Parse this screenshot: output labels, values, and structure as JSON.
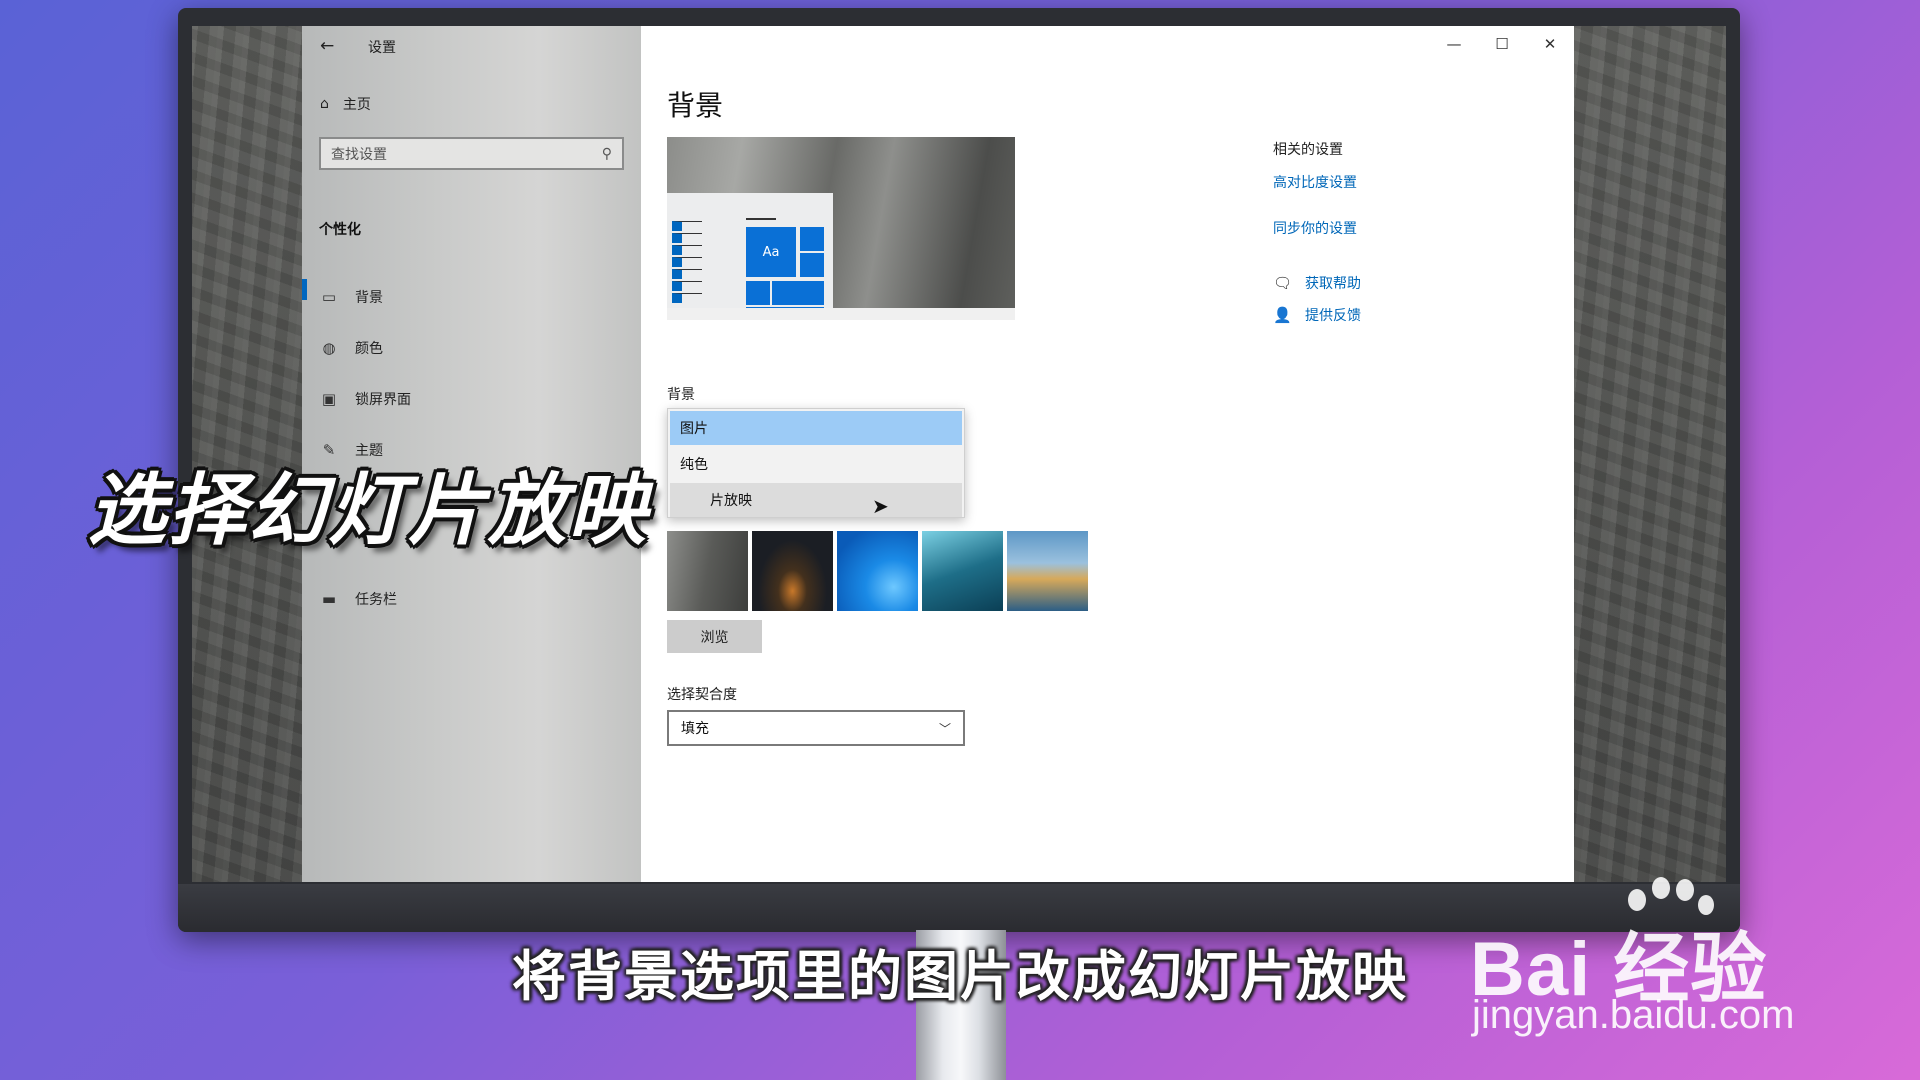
{
  "window": {
    "back_icon": "back-arrow-icon",
    "title": "设置",
    "controls": {
      "minimize": "—",
      "maximize": "☐",
      "close": "✕"
    }
  },
  "sidebar": {
    "home_label": "主页",
    "search_placeholder": "查找设置",
    "section_title": "个性化",
    "items": [
      {
        "label": "背景",
        "icon": "image-icon",
        "active": true
      },
      {
        "label": "颜色",
        "icon": "palette-icon",
        "active": false
      },
      {
        "label": "锁屏界面",
        "icon": "lock-screen-icon",
        "active": false
      },
      {
        "label": "主题",
        "icon": "theme-icon",
        "active": false
      },
      {
        "label": "",
        "icon": "",
        "active": false
      },
      {
        "label": "",
        "icon": "",
        "active": false
      },
      {
        "label": "任务栏",
        "icon": "taskbar-icon",
        "active": false
      }
    ]
  },
  "main": {
    "page_title": "背景",
    "preview_tile_text": "Aa",
    "background_label": "背景",
    "dropdown_options": [
      "图片",
      "纯色",
      "幻灯片放映"
    ],
    "dropdown_visible_options": [
      "图片",
      "纯色",
      "片放映"
    ],
    "dropdown_selected": "图片",
    "browse_label": "浏览",
    "fit_label": "选择契合度",
    "fit_value": "填充"
  },
  "related": {
    "heading": "相关的设置",
    "links": [
      "高对比度设置",
      "同步你的设置"
    ],
    "help": [
      "获取帮助",
      "提供反馈"
    ]
  },
  "captions": {
    "big": "选择幻灯片放映",
    "subtitle": "将背景选项里的图片改成幻灯片放映"
  },
  "watermark": {
    "brand": "Bai  经验",
    "domain": "jingyan.baidu.com"
  },
  "colors": {
    "accent": "#0067c0",
    "link": "#0067b8",
    "dropdown_selected": "#9ccbf6"
  }
}
